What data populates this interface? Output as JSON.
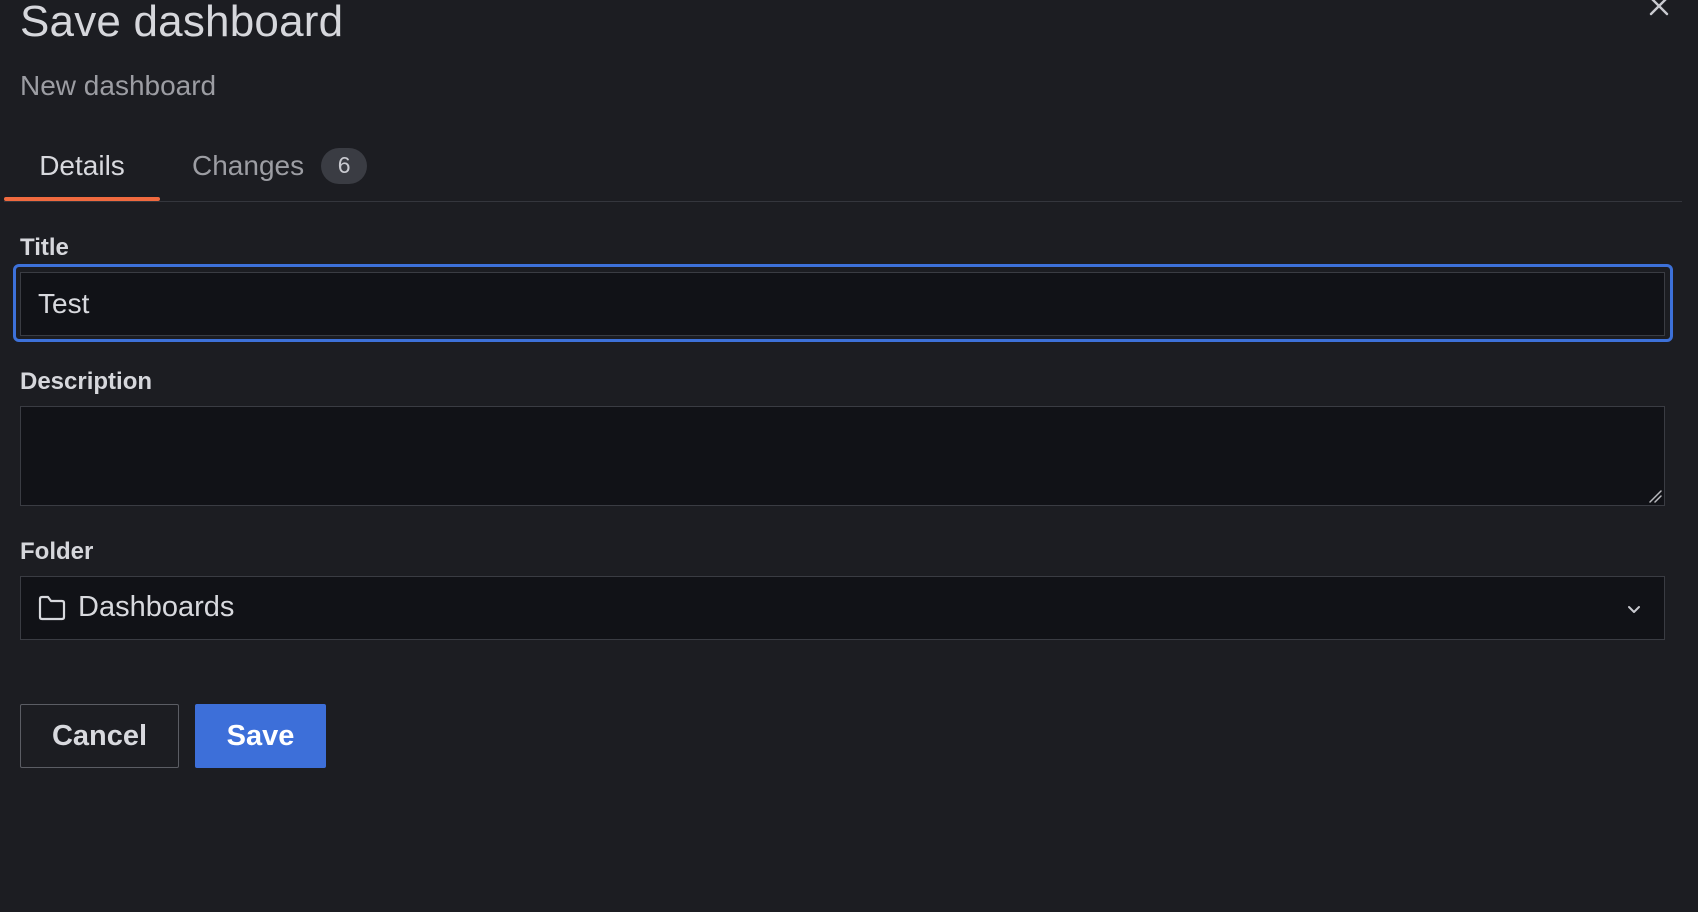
{
  "drawer": {
    "title": "Save dashboard",
    "subtitle": "New dashboard",
    "close_icon": "close-icon"
  },
  "tabs": [
    {
      "label": "Details",
      "active": true
    },
    {
      "label": "Changes",
      "badge": "6",
      "active": false
    }
  ],
  "form": {
    "title_label": "Title",
    "title_value": "Test",
    "description_label": "Description",
    "description_value": "",
    "folder_label": "Folder",
    "folder_value": "Dashboards",
    "folder_icon": "folder-icon",
    "dropdown_icon": "chevron-down-icon"
  },
  "actions": {
    "cancel_label": "Cancel",
    "save_label": "Save"
  },
  "colors": {
    "background": "#1c1d22",
    "input_background": "#111217",
    "focus_border": "#3d71d9",
    "primary_button": "#3d6fd9",
    "active_tab_underline": "#f06a3f"
  }
}
